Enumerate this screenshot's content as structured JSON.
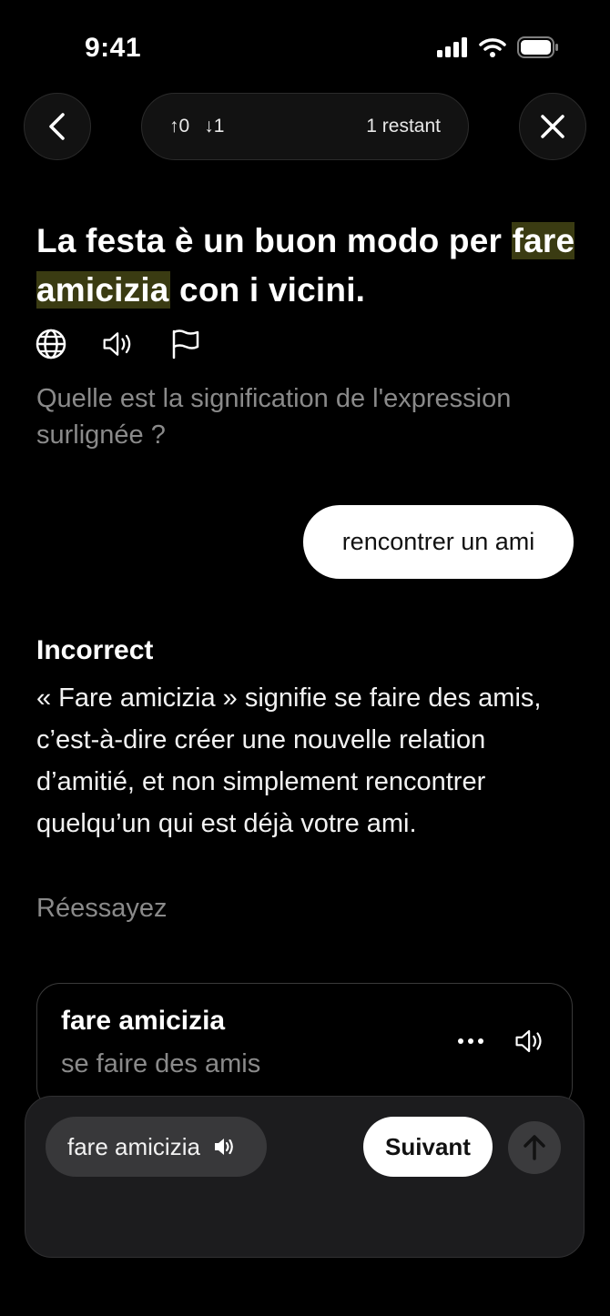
{
  "status_bar": {
    "time": "9:41"
  },
  "header": {
    "up_count": "↑0",
    "down_count": "↓1",
    "remaining": "1 restant"
  },
  "exercise": {
    "sentence_before": "La festa è un buon modo per ",
    "sentence_highlight": "fare amicizia",
    "sentence_after": " con i vicini.",
    "question": "Quelle est la signification de l'expression surlignée ?"
  },
  "answer": {
    "user_answer": "rencontrer un ami"
  },
  "feedback": {
    "title": "Incorrect",
    "explanation": "« Fare amicizia » signifie se faire des amis, c’est-à-dire créer une nouvelle relation d’amitié, et non simplement rencontrer quelqu’un qui est déjà votre ami.",
    "retry": "Réessayez"
  },
  "vocab_card": {
    "term": "fare amicizia",
    "definition": "se faire des amis"
  },
  "bottom_bar": {
    "chip_label": "fare amicizia",
    "next_label": "Suivant"
  },
  "colors": {
    "background": "#000000",
    "highlight": "#3a3b12",
    "muted_text": "#8a8a8a",
    "panel": "#1c1c1e"
  }
}
